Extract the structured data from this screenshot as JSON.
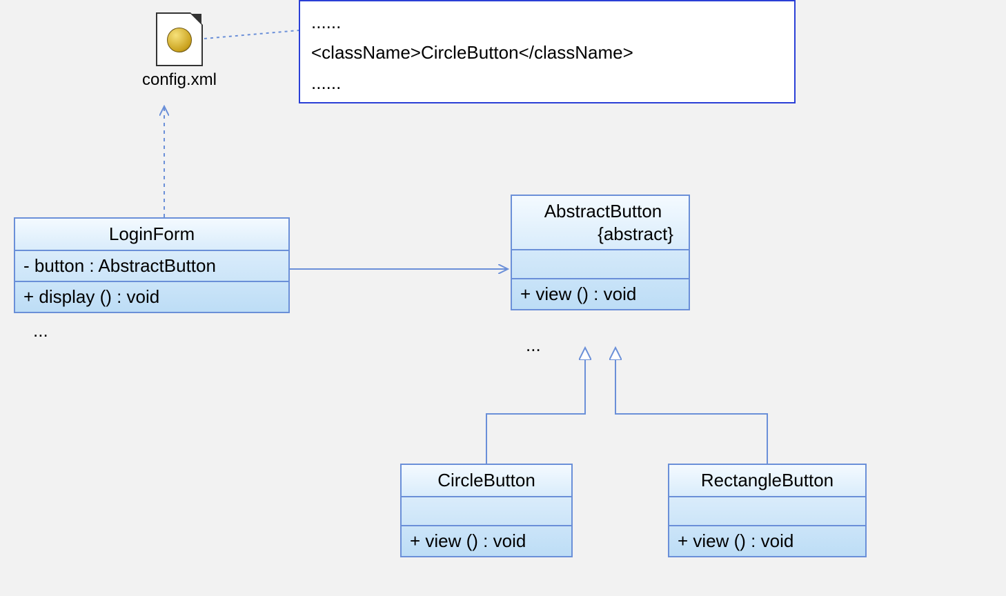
{
  "artifact": {
    "label": "config.xml"
  },
  "note": {
    "line1": "......",
    "line2": "<className>CircleButton</className>",
    "line3": "......"
  },
  "classes": {
    "loginForm": {
      "name": "LoginForm",
      "attr1": "- button : AbstractButton",
      "op1": "+ display () : void",
      "ellipsis": "..."
    },
    "abstractButton": {
      "name": "AbstractButton",
      "stereotype": "{abstract}",
      "op1": "+ view () : void",
      "ellipsis": "..."
    },
    "circleButton": {
      "name": "CircleButton",
      "op1": "+ view () : void"
    },
    "rectangleButton": {
      "name": "RectangleButton",
      "op1": "+ view () : void"
    }
  },
  "relations": {
    "loginForm_to_config": "dependency",
    "loginForm_to_abstractButton": "association",
    "circleButton_to_abstractButton": "generalization",
    "rectangleButton_to_abstractButton": "generalization",
    "config_to_note": "anchor"
  }
}
